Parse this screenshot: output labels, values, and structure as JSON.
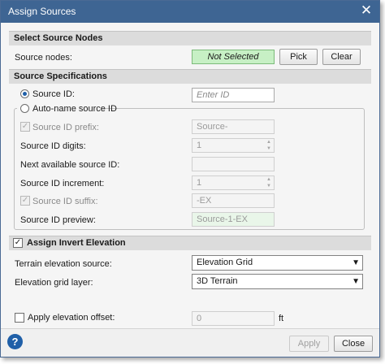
{
  "window": {
    "title": "Assign Sources"
  },
  "select_source_nodes": {
    "header": "Select Source Nodes",
    "source_nodes_label": "Source nodes:",
    "status": "Not Selected",
    "pick_label": "Pick",
    "clear_label": "Clear",
    "status_color": "#c7f0c5"
  },
  "source_specifications": {
    "header": "Source Specifications",
    "source_id": {
      "label": "Source ID:",
      "placeholder": "Enter ID",
      "selected": true
    },
    "auto_name": {
      "label": "Auto-name source ID",
      "selected": false,
      "prefix": {
        "label": "Source ID prefix:",
        "value": "Source-",
        "checked": true
      },
      "digits": {
        "label": "Source ID digits:",
        "value": "1"
      },
      "next_available": {
        "label": "Next available source ID:",
        "value": ""
      },
      "increment": {
        "label": "Source ID increment:",
        "value": "1"
      },
      "suffix": {
        "label": "Source ID suffix:",
        "value": "-EX",
        "checked": true
      },
      "preview": {
        "label": "Source ID preview:",
        "value": "Source-1-EX"
      }
    }
  },
  "assign_invert_elevation": {
    "header": "Assign Invert Elevation",
    "checked": true,
    "terrain_source": {
      "label": "Terrain elevation source:",
      "value": "Elevation Grid"
    },
    "grid_layer": {
      "label": "Elevation grid layer:",
      "value": "3D Terrain"
    },
    "elevation_offset": {
      "label": "Apply elevation offset:",
      "value": "0",
      "unit": "ft",
      "checked": false
    }
  },
  "footer": {
    "apply_label": "Apply",
    "close_label": "Close",
    "help_icon": "question-mark-icon"
  },
  "colors": {
    "titlebar": "#3e6593",
    "accent": "#1f5fa8"
  }
}
